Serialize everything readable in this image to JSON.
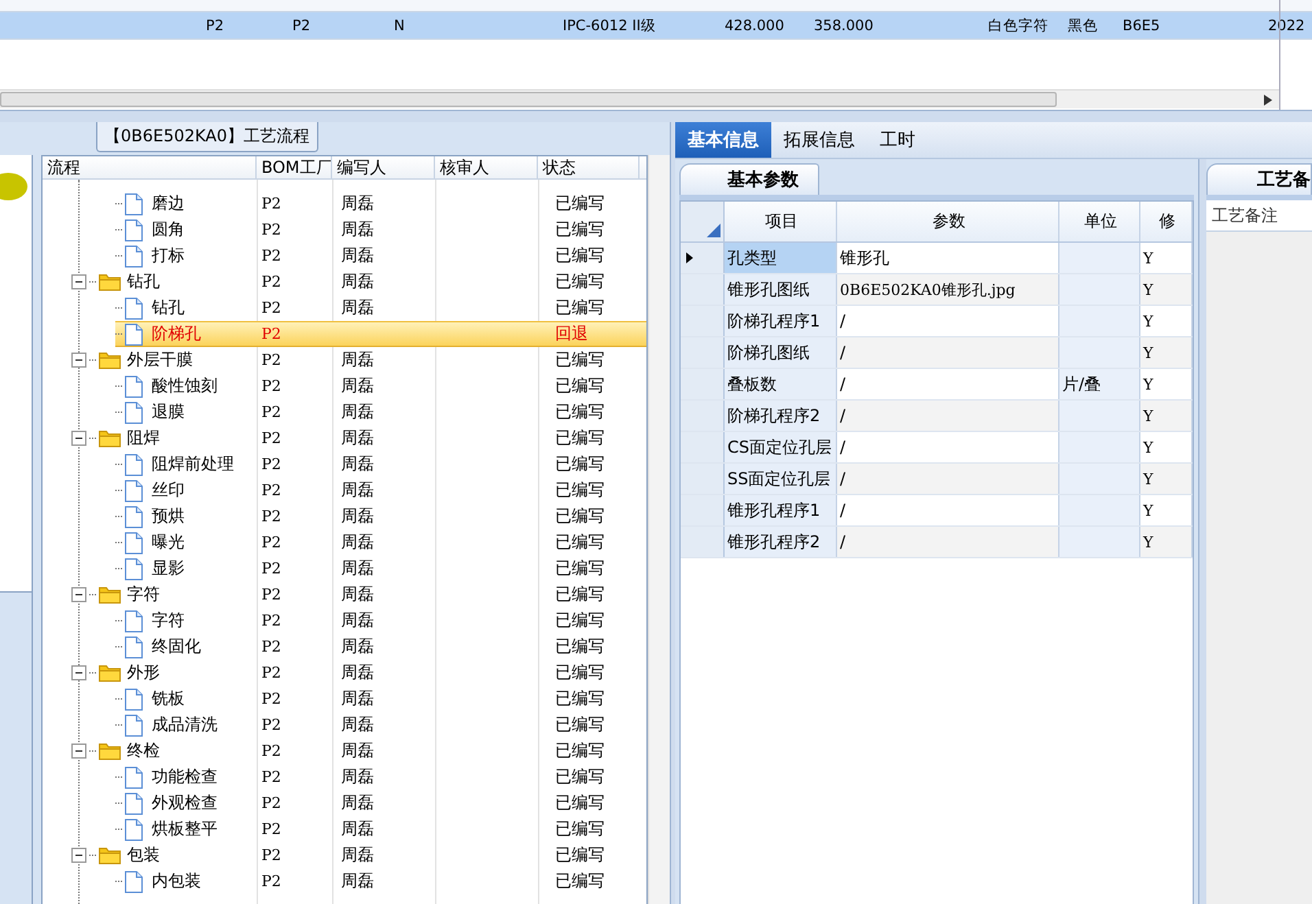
{
  "top_grid": {
    "row": {
      "selected": true,
      "cells": [
        "P2",
        "P2",
        "N",
        "IPC-6012 II级",
        "428.000",
        "358.000",
        "白色字符",
        "黑色",
        "B6E5",
        "2022"
      ]
    }
  },
  "process_panel": {
    "title": "【0B6E502KA0】工艺流程",
    "columns": [
      "流程",
      "BOM工厂",
      "编写人",
      "核审人",
      "状态"
    ],
    "tree": [
      {
        "children": [
          {
            "label": "磨边",
            "bom": "P2",
            "writer": "周磊",
            "status": "已编写",
            "selected": false,
            "returned": false
          },
          {
            "label": "圆角",
            "bom": "P2",
            "writer": "周磊",
            "status": "已编写",
            "selected": false,
            "returned": false
          },
          {
            "label": "打标",
            "bom": "P2",
            "writer": "周磊",
            "status": "已编写",
            "selected": false,
            "returned": false
          }
        ]
      },
      {
        "label": "钻孔",
        "bom": "P2",
        "writer": "周磊",
        "status": "已编写",
        "selected": false,
        "returned": false,
        "expanded": true,
        "children": [
          {
            "label": "钻孔",
            "bom": "P2",
            "writer": "周磊",
            "status": "已编写",
            "selected": false,
            "returned": false
          },
          {
            "label": "阶梯孔",
            "bom": "P2",
            "status": "回退",
            "selected": true,
            "returned": true
          }
        ]
      },
      {
        "label": "外层干膜",
        "bom": "P2",
        "writer": "周磊",
        "status": "已编写",
        "selected": false,
        "returned": false,
        "expanded": true,
        "children": [
          {
            "label": "酸性蚀刻",
            "bom": "P2",
            "writer": "周磊",
            "status": "已编写",
            "selected": false,
            "returned": false
          },
          {
            "label": "退膜",
            "bom": "P2",
            "writer": "周磊",
            "status": "已编写",
            "selected": false,
            "returned": false
          }
        ]
      },
      {
        "label": "阻焊",
        "bom": "P2",
        "writer": "周磊",
        "status": "已编写",
        "selected": false,
        "returned": false,
        "expanded": true,
        "children": [
          {
            "label": "阻焊前处理",
            "bom": "P2",
            "writer": "周磊",
            "status": "已编写",
            "selected": false,
            "returned": false
          },
          {
            "label": "丝印",
            "bom": "P2",
            "writer": "周磊",
            "status": "已编写",
            "selected": false,
            "returned": false
          },
          {
            "label": "预烘",
            "bom": "P2",
            "writer": "周磊",
            "status": "已编写",
            "selected": false,
            "returned": false
          },
          {
            "label": "曝光",
            "bom": "P2",
            "writer": "周磊",
            "status": "已编写",
            "selected": false,
            "returned": false
          },
          {
            "label": "显影",
            "bom": "P2",
            "writer": "周磊",
            "status": "已编写",
            "selected": false,
            "returned": false
          }
        ]
      },
      {
        "label": "字符",
        "bom": "P2",
        "writer": "周磊",
        "status": "已编写",
        "selected": false,
        "returned": false,
        "expanded": true,
        "children": [
          {
            "label": "字符",
            "bom": "P2",
            "writer": "周磊",
            "status": "已编写",
            "selected": false,
            "returned": false
          },
          {
            "label": "终固化",
            "bom": "P2",
            "writer": "周磊",
            "status": "已编写",
            "selected": false,
            "returned": false
          }
        ]
      },
      {
        "label": "外形",
        "bom": "P2",
        "writer": "周磊",
        "status": "已编写",
        "selected": false,
        "returned": false,
        "expanded": true,
        "children": [
          {
            "label": "铣板",
            "bom": "P2",
            "writer": "周磊",
            "status": "已编写",
            "selected": false,
            "returned": false
          },
          {
            "label": "成品清洗",
            "bom": "P2",
            "writer": "周磊",
            "status": "已编写",
            "selected": false,
            "returned": false
          }
        ]
      },
      {
        "label": "终检",
        "bom": "P2",
        "writer": "周磊",
        "status": "已编写",
        "selected": false,
        "returned": false,
        "expanded": true,
        "children": [
          {
            "label": "功能检查",
            "bom": "P2",
            "writer": "周磊",
            "status": "已编写",
            "selected": false,
            "returned": false
          },
          {
            "label": "外观检查",
            "bom": "P2",
            "writer": "周磊",
            "status": "已编写",
            "selected": false,
            "returned": false
          },
          {
            "label": "烘板整平",
            "bom": "P2",
            "writer": "周磊",
            "status": "已编写",
            "selected": false,
            "returned": false
          }
        ]
      },
      {
        "label": "包装",
        "bom": "P2",
        "writer": "周磊",
        "status": "已编写",
        "selected": false,
        "returned": false,
        "expanded": true,
        "children": [
          {
            "label": "内包装",
            "bom": "P2",
            "writer": "周磊",
            "status": "已编写",
            "selected": false,
            "returned": false
          }
        ]
      }
    ]
  },
  "detail_panel": {
    "tabs": [
      {
        "label": "基本信息",
        "selected": true
      },
      {
        "label": "拓展信息",
        "selected": false
      },
      {
        "label": "工时",
        "selected": false
      }
    ],
    "sub_tab": "基本参数",
    "columns": [
      "项目",
      "参数",
      "单位",
      "修"
    ],
    "rows": [
      {
        "item": "孔类型",
        "value": "锥形孔",
        "flag": "Y",
        "selected": true
      },
      {
        "item": "锥形孔图纸",
        "value": "0B6E502KA0锥形孔.jpg",
        "flag": "Y",
        "selected": false
      },
      {
        "item": "阶梯孔程序1",
        "value": "/",
        "flag": "Y",
        "selected": false
      },
      {
        "item": "阶梯孔图纸",
        "value": "/",
        "flag": "Y",
        "selected": false
      },
      {
        "item": "叠板数",
        "value": "/",
        "unit": "片/叠",
        "flag": "Y",
        "selected": false
      },
      {
        "item": "阶梯孔程序2",
        "value": "/",
        "flag": "Y",
        "selected": false
      },
      {
        "item": "CS面定位孔层",
        "value": "/",
        "flag": "Y",
        "selected": false
      },
      {
        "item": "SS面定位孔层",
        "value": "/",
        "flag": "Y",
        "selected": false
      },
      {
        "item": "锥形孔程序1",
        "value": "/",
        "flag": "Y",
        "selected": false
      },
      {
        "item": "锥形孔程序2",
        "value": "/",
        "flag": "Y",
        "selected": false
      }
    ]
  },
  "notes_panel": {
    "tab": "工艺备",
    "label": "工艺备注"
  }
}
